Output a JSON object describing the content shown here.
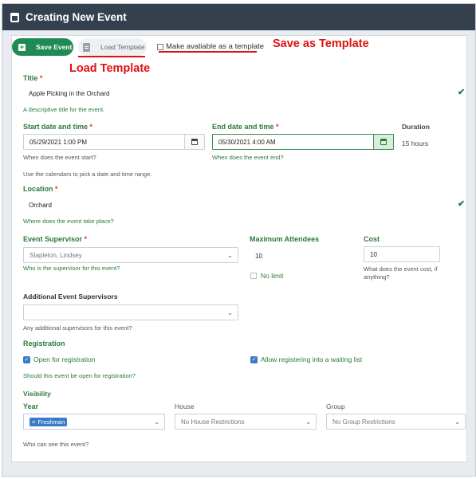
{
  "window": {
    "title": "Creating New Event"
  },
  "toolbar": {
    "save_label": "Save Event",
    "load_label": "Load Template",
    "template_checkbox_label": "Make avaliable as a template"
  },
  "annotations": {
    "save_as_template": "Save as Template",
    "load_template": "Load Template",
    "color": "#e01010"
  },
  "form": {
    "title": {
      "label": "Title",
      "required": "*",
      "value": "Apple Picking in the Orchard",
      "hint": "A descriptive title for the event."
    },
    "start": {
      "label": "Start date and time",
      "required": "*",
      "value": "05/29/2021 1:00 PM",
      "hint": "When does the event start?"
    },
    "end": {
      "label": "End date and time",
      "required": "*",
      "value": "05/30/2021 4:00 AM",
      "hint": "When does the event end?"
    },
    "duration": {
      "label": "Duration",
      "value": "15 hours"
    },
    "calendar_hint": "Use the calendars to pick a date and time range.",
    "location": {
      "label": "Location",
      "required": "*",
      "value": "Orchard",
      "hint": "Where does the event take place?"
    },
    "supervisor": {
      "label": "Event Supervisor",
      "required": "*",
      "value": "Stapleton, Lindsey",
      "hint": "Who is the supervisor for this event?"
    },
    "max_attendees": {
      "label": "Maximum Attendees",
      "value": "10",
      "no_limit_label": "No limit"
    },
    "cost": {
      "label": "Cost",
      "value": "10",
      "hint": "What does the event cost, if anything?"
    },
    "additional_supervisors": {
      "label": "Additional Event Supervisors",
      "value": "",
      "hint": "Any additional supervisors for this event?"
    },
    "registration": {
      "label": "Registration",
      "open_label": "Open for registration",
      "waiting_label": "Allow registering into a waiting list",
      "hint": "Should this event be open for registration?"
    },
    "visibility": {
      "label": "Visibility",
      "year_label": "Year",
      "year_tag": "Freshman",
      "year_tag_remove": "×",
      "house_label": "House",
      "house_value": "No House Restrictions",
      "group_label": "Group",
      "group_value": "No Group Restrictions",
      "hint": "Who can see this event?"
    }
  },
  "icons": {
    "calendar": "calendar-icon",
    "check": "checkmark",
    "caret": "chevron-down",
    "checkmark_glyph": "✔",
    "caret_glyph": "⌄",
    "checkbox_glyph": "✓"
  },
  "colors": {
    "header": "#34404e",
    "accent_green": "#1f8a54",
    "label_green": "#2a7a3a",
    "checkbox_blue": "#3a7cc4"
  }
}
